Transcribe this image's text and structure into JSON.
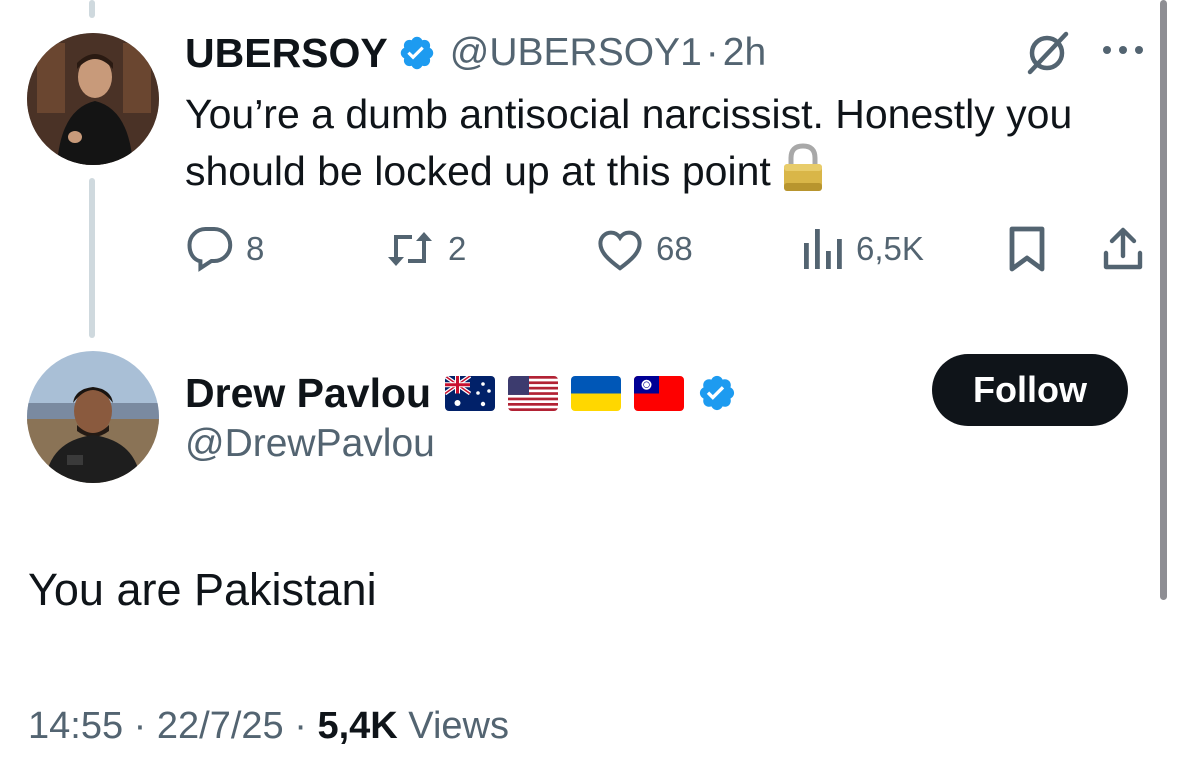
{
  "reply": {
    "display_name": "UBERSOY",
    "handle": "@UBERSOY1",
    "separator": "·",
    "time": "2h",
    "text": "You’re a dumb antisocial narcissist. Honestly you should be locked up at this point",
    "emoji_icon": "lock-icon",
    "stats": {
      "replies": "8",
      "retweets": "2",
      "likes": "68",
      "views": "6,5K"
    }
  },
  "main": {
    "display_name": "Drew Pavlou",
    "handle": "@DrewPavlou",
    "flags": [
      "australia-flag",
      "usa-flag",
      "ukraine-flag",
      "taiwan-flag"
    ],
    "follow_label": "Follow",
    "text": "You are Pakistani",
    "timestamp": "14:55",
    "date": "22/7/25",
    "separator": "·",
    "views_count": "5,4K",
    "views_label": "Views"
  },
  "colors": {
    "text_primary": "#0f1419",
    "text_secondary": "#536471",
    "verified_blue": "#1d9bf0",
    "thread_line": "#cfd9de",
    "button_dark": "#0f1419"
  }
}
